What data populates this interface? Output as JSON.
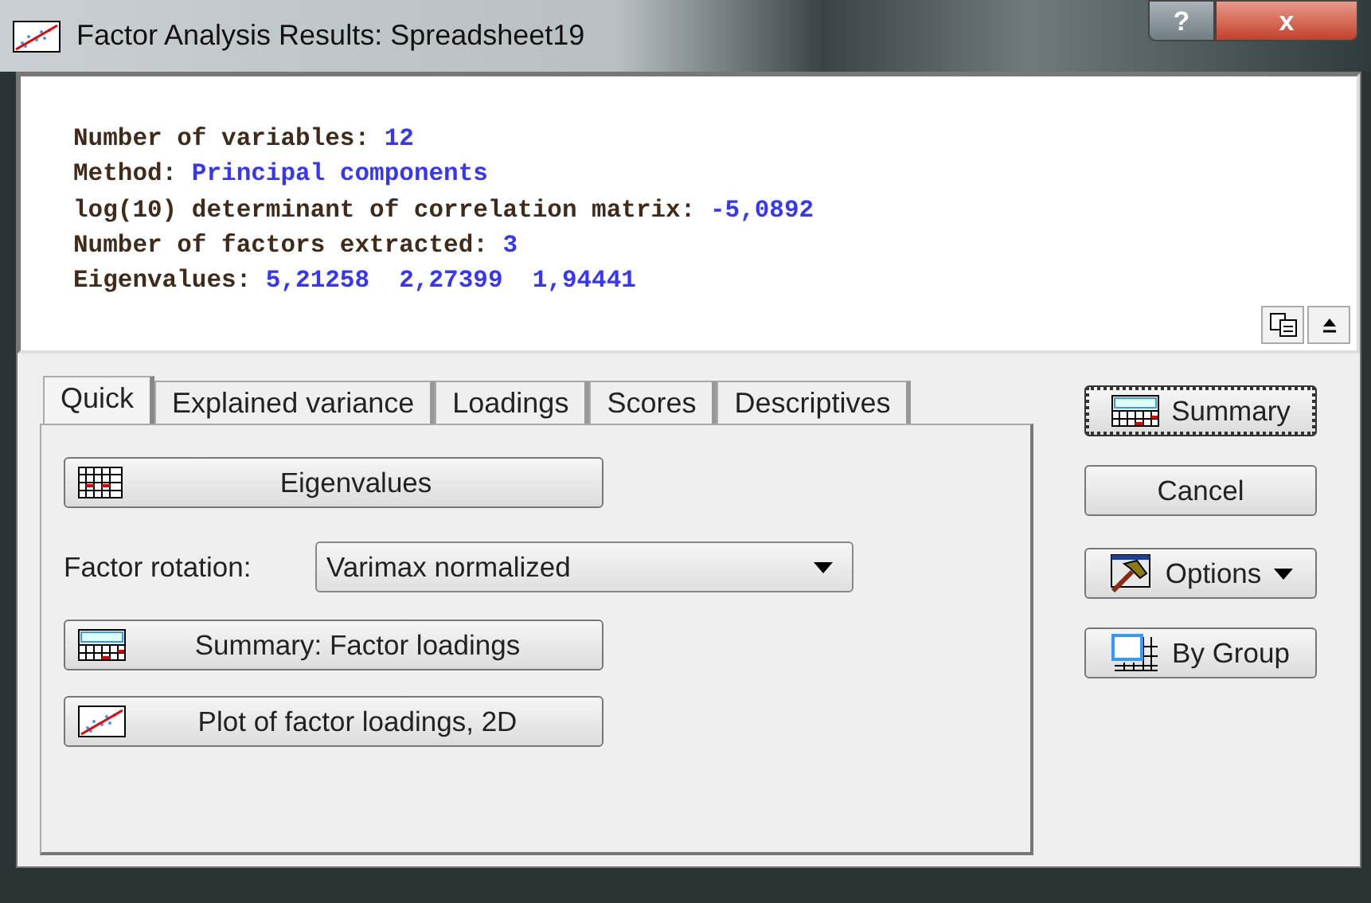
{
  "window": {
    "title": "Factor Analysis Results: Spreadsheet19",
    "help_glyph": "?",
    "close_glyph": "x"
  },
  "output": {
    "lines": [
      {
        "label": "Number of variables:",
        "value": "12"
      },
      {
        "label": "Method:",
        "value": "Principal components"
      },
      {
        "label": "log(10) determinant of correlation matrix:",
        "value": "-5,0892"
      },
      {
        "label": "Number of factors extracted:",
        "value": "3"
      },
      {
        "label": "Eigenvalues:",
        "value": "5,21258  2,27399  1,94441"
      }
    ]
  },
  "tabs": [
    {
      "label": "Quick",
      "selected": true
    },
    {
      "label": "Explained variance",
      "selected": false
    },
    {
      "label": "Loadings",
      "selected": false
    },
    {
      "label": "Scores",
      "selected": false
    },
    {
      "label": "Descriptives",
      "selected": false
    }
  ],
  "quick": {
    "buttons": [
      {
        "label": "Eigenvalues"
      },
      {
        "kind": "select",
        "label": "Factor rotation:",
        "value": "Varimax normalized"
      },
      {
        "label": "Summary: Factor loadings"
      },
      {
        "label": "Plot of factor loadings, 2D"
      }
    ]
  },
  "side_buttons": [
    {
      "label": "Summary",
      "default": true,
      "dropdown": false
    },
    {
      "label": "Cancel",
      "default": false,
      "dropdown": false
    },
    {
      "label": "Options",
      "default": false,
      "dropdown": true
    },
    {
      "label": "By Group",
      "default": false,
      "dropdown": false
    }
  ]
}
